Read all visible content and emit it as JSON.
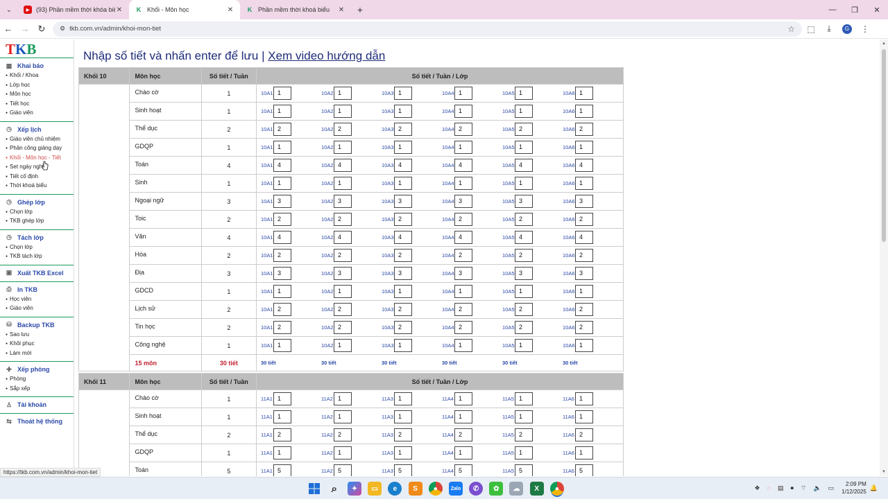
{
  "browser": {
    "tabs": [
      {
        "title": "(93) Phần mềm thời khóa biểu",
        "icon": "youtube-icon",
        "active": false
      },
      {
        "title": "Khối - Môn học",
        "icon": "tkb-k-icon",
        "active": true
      },
      {
        "title": "Phần mềm thời khoá biểu",
        "icon": "tkb-k-icon",
        "active": false
      }
    ],
    "url": "tkb.com.vn/admin/khoi-mon-tiet",
    "profile_initial": "G",
    "status_url": "https://tkb.com.vn/admin/khoi-mon-tiet"
  },
  "sidebar": {
    "logo": {
      "t": "T",
      "k": "K",
      "b": "B"
    },
    "sections": [
      {
        "title": "Khai báo",
        "icon": "building-icon",
        "items": [
          "Khối / Khoa",
          "Lớp học",
          "Môn học",
          "Tiết học",
          "Giáo viên"
        ]
      },
      {
        "title": "Xếp lịch",
        "icon": "clock-icon",
        "items": [
          "Giáo viên chủ nhiệm",
          "Phân công giảng dạy",
          "Khối - Môn học - Tiết",
          "Set ngày nghỉ",
          "Tiết cố định",
          "Thời khoá biểu"
        ]
      },
      {
        "title": "Ghép lớp",
        "icon": "clock-icon",
        "items": [
          "Chọn lớp",
          "TKB ghép lớp"
        ]
      },
      {
        "title": "Tách lớp",
        "icon": "clock-icon",
        "items": [
          "Chọn lớp",
          "TKB tách lớp"
        ]
      },
      {
        "title": "Xuất TKB Excel",
        "icon": "excel-icon",
        "items": []
      },
      {
        "title": "In TKB",
        "icon": "printer-icon",
        "items": [
          "Học viên",
          "Giáo viên"
        ]
      },
      {
        "title": "Backup TKB",
        "icon": "database-icon",
        "items": [
          "Sao lưu",
          "Khôi phục",
          "Làm mới"
        ]
      },
      {
        "title": "Xếp phòng",
        "icon": "puzzle-icon",
        "items": [
          "Phòng",
          "Sắp xếp"
        ]
      },
      {
        "title": "Tài khoản",
        "icon": "user-icon",
        "items": []
      },
      {
        "title": "Thoát hệ thống",
        "icon": "logout-icon",
        "items": []
      }
    ],
    "active_item": "Khối - Môn học - Tiết"
  },
  "page": {
    "title_main": "Nhập số tiết và nhấn enter để lưu",
    "title_sep": "|",
    "title_link": "Xem video hướng dẫn"
  },
  "blocks": [
    {
      "header": {
        "khoi": "Khối 10",
        "mon": "Môn học",
        "sotiet": "Số tiết / Tuần",
        "lop": "Số tiết / Tuần / Lớp"
      },
      "classes": [
        "10A1",
        "10A2",
        "10A3",
        "10A4",
        "10A5",
        "10A6"
      ],
      "subjects": [
        {
          "name": "Chào cờ",
          "total": "1",
          "values": [
            "1",
            "1",
            "1",
            "1",
            "1",
            "1"
          ]
        },
        {
          "name": "Sinh hoạt",
          "total": "1",
          "values": [
            "1",
            "1",
            "1",
            "1",
            "1",
            "1"
          ]
        },
        {
          "name": "Thể dục",
          "total": "2",
          "values": [
            "2",
            "2",
            "2",
            "2",
            "2",
            "2"
          ]
        },
        {
          "name": "GDQP",
          "total": "1",
          "values": [
            "1",
            "1",
            "1",
            "1",
            "1",
            "1"
          ]
        },
        {
          "name": "Toán",
          "total": "4",
          "values": [
            "4",
            "4",
            "4",
            "4",
            "4",
            "4"
          ]
        },
        {
          "name": "Sinh",
          "total": "1",
          "values": [
            "1",
            "1",
            "1",
            "1",
            "1",
            "1"
          ]
        },
        {
          "name": "Ngoại ngữ",
          "total": "3",
          "values": [
            "3",
            "3",
            "3",
            "3",
            "3",
            "3"
          ]
        },
        {
          "name": "Toic",
          "total": "2",
          "values": [
            "2",
            "2",
            "2",
            "2",
            "2",
            "2"
          ]
        },
        {
          "name": "Văn",
          "total": "4",
          "values": [
            "4",
            "4",
            "4",
            "4",
            "4",
            "4"
          ]
        },
        {
          "name": "Hóa",
          "total": "2",
          "values": [
            "2",
            "2",
            "2",
            "2",
            "2",
            "2"
          ]
        },
        {
          "name": "Địa",
          "total": "3",
          "values": [
            "3",
            "3",
            "3",
            "3",
            "3",
            "3"
          ]
        },
        {
          "name": "GDCD",
          "total": "1",
          "values": [
            "1",
            "1",
            "1",
            "1",
            "1",
            "1"
          ]
        },
        {
          "name": "Lịch sử",
          "total": "2",
          "values": [
            "2",
            "2",
            "2",
            "2",
            "2",
            "2"
          ]
        },
        {
          "name": "Tin học",
          "total": "2",
          "values": [
            "2",
            "2",
            "2",
            "2",
            "2",
            "2"
          ]
        },
        {
          "name": "Công nghệ",
          "total": "1",
          "values": [
            "1",
            "1",
            "1",
            "1",
            "1",
            "1"
          ]
        }
      ],
      "summary": {
        "mon": "15 môn",
        "tiet": "30 tiết",
        "class_totals": [
          "30 tiết",
          "30 tiết",
          "30 tiết",
          "30 tiết",
          "30 tiết",
          "30 tiết"
        ]
      }
    },
    {
      "header": {
        "khoi": "Khối 11",
        "mon": "Môn học",
        "sotiet": "Số tiết / Tuần",
        "lop": "Số tiết / Tuần / Lớp"
      },
      "classes": [
        "11A1",
        "11A2",
        "11A3",
        "11A4",
        "11A5",
        "11A6"
      ],
      "subjects": [
        {
          "name": "Chào cờ",
          "total": "1",
          "values": [
            "1",
            "1",
            "1",
            "1",
            "1",
            "1"
          ]
        },
        {
          "name": "Sinh hoạt",
          "total": "1",
          "values": [
            "1",
            "1",
            "1",
            "1",
            "1",
            "1"
          ]
        },
        {
          "name": "Thể dục",
          "total": "2",
          "values": [
            "2",
            "2",
            "2",
            "2",
            "2",
            "2"
          ]
        },
        {
          "name": "GDQP",
          "total": "1",
          "values": [
            "1",
            "1",
            "1",
            "1",
            "1",
            "1"
          ]
        },
        {
          "name": "Toán",
          "total": "5",
          "values": [
            "5",
            "5",
            "5",
            "5",
            "5",
            "5"
          ]
        }
      ]
    }
  ],
  "taskbar": {
    "time": "2:09 PM",
    "date": "1/12/2025",
    "apps": [
      "windows-start-icon",
      "search-icon",
      "copilot-icon",
      "file-explorer-icon",
      "edge-icon",
      "sublime-icon",
      "chrome-icon",
      "zalo-icon",
      "viber-icon",
      "wechat-icon",
      "cloud-icon",
      "excel-icon",
      "chrome-active-icon"
    ],
    "zalo_label": "Zalo",
    "excel_label": "X"
  }
}
